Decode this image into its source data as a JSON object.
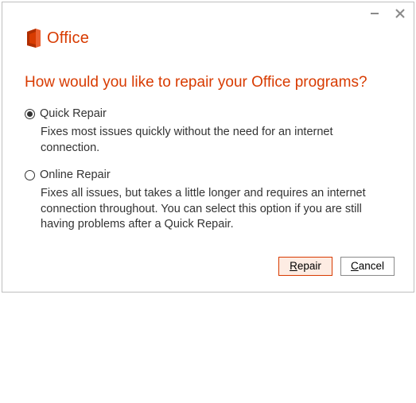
{
  "brand": {
    "name": "Office",
    "color": "#d83b01"
  },
  "heading": "How would you like to repair your Office programs?",
  "options": [
    {
      "label": "Quick Repair",
      "description": "Fixes most issues quickly without the need for an internet connection.",
      "selected": true
    },
    {
      "label": "Online Repair",
      "description": "Fixes all issues, but takes a little longer and requires an internet connection throughout. You can select this option if you are still having problems after a Quick Repair.",
      "selected": false
    }
  ],
  "buttons": {
    "repair": "Repair",
    "cancel": "Cancel"
  }
}
